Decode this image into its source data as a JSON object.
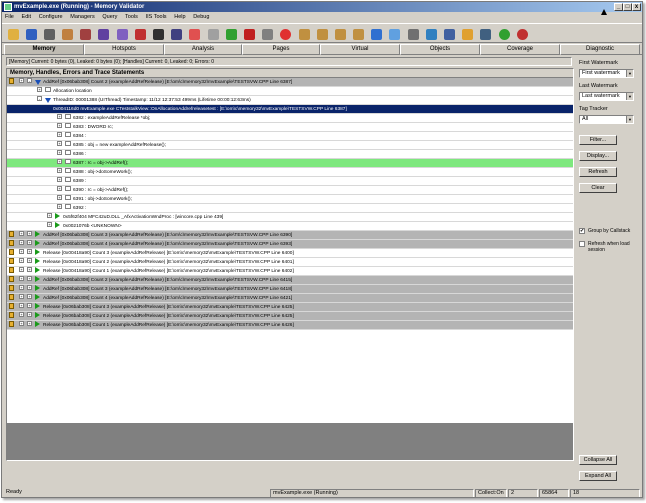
{
  "window": {
    "title": "mvExample.exe (Running) - Memory Validator",
    "controls": {
      "minimize": "_",
      "maximize": "□",
      "close": "x"
    }
  },
  "menu": [
    "File",
    "Edit",
    "Configure",
    "Managers",
    "Query",
    "Tools",
    "IIS Tools",
    "Help",
    "Debug"
  ],
  "toolbar": {
    "icons": [
      "folder-open-icon",
      "save-icon",
      "print-icon",
      "clipboard-icon",
      "book-icon",
      "wand-icon",
      "magic-icon",
      "red-pencil-icon",
      "arrow-icon",
      "pencil-icon",
      "eraser-icon",
      "knife-icon",
      "check-icon",
      "close-icon",
      "stop-icon",
      "record-icon",
      "bag-icon",
      "bag-icon",
      "bag-icon",
      "bag-icon",
      "shield-icon",
      "snowflake-icon",
      "grid-icon",
      "chart-icon",
      "network-icon",
      "lock-icon",
      "person-icon",
      "refresh-green-icon",
      "refresh-red-icon"
    ]
  },
  "tabs": [
    "Memory",
    "Hotspots",
    "Analysis",
    "Pages",
    "Virtual",
    "Objects",
    "Coverage",
    "Diagnostic"
  ],
  "active_tab": "Memory",
  "status_summary": "[Memory] Current: 0 bytes (0), Leaked: 0 bytes (0); [Handles] Current: 0, Leaked: 0; Errors: 0",
  "tree": {
    "header": "Memory, Handles, Errors and Trace Statements",
    "rows": [
      {
        "indent": 0,
        "style": "grey",
        "text": "AddRef [0x06bab308] Count 2 (exampleAddRefRelease) [E:\\om\\c\\memory32\\mvExample\\TESTSVW.CPP Line 6387]",
        "kind": "arrowdown"
      },
      {
        "indent": 1,
        "style": "white",
        "text": "Allocation location",
        "kind": "box"
      },
      {
        "indent": 1,
        "style": "white",
        "text": "ThreadID: 00001388 (UIThread) Timestamp: 11/12 12:37:53 499ms (Lifetime 00:00:12:63ms)",
        "kind": "arrowdown"
      },
      {
        "indent": 2,
        "style": "sel",
        "text": "0x004116d0 mvExample.exe CTeststalkView::OnAllocationAddrefreleasetest : [E:\\om\\c\\memory32\\mvExample\\TESTSVW.CPP Line 6387]",
        "kind": "none"
      },
      {
        "indent": 3,
        "style": "white",
        "text": "6382 :     exampleAddRefRelease     *obj;",
        "kind": "box"
      },
      {
        "indent": 3,
        "style": "white",
        "text": "6383 :     DWORD                   rc;",
        "kind": "box"
      },
      {
        "indent": 3,
        "style": "white",
        "text": "6384 :",
        "kind": "box"
      },
      {
        "indent": 3,
        "style": "white",
        "text": "6385 :     obj = new exampleAddRefRelease();",
        "kind": "box"
      },
      {
        "indent": 3,
        "style": "white",
        "text": "6386 :",
        "kind": "box"
      },
      {
        "indent": 3,
        "style": "green",
        "text": "6387 :     rc = obj->AddRef();",
        "kind": "box"
      },
      {
        "indent": 3,
        "style": "white",
        "text": "6388 :     obj->doSomeWork();",
        "kind": "box"
      },
      {
        "indent": 3,
        "style": "white",
        "text": "6389 :",
        "kind": "box"
      },
      {
        "indent": 3,
        "style": "white",
        "text": "6390 :     rc = obj->AddRef();",
        "kind": "box"
      },
      {
        "indent": 3,
        "style": "white",
        "text": "6391 :     obj->doSomeWork();",
        "kind": "box"
      },
      {
        "indent": 3,
        "style": "white",
        "text": "6392 :",
        "kind": "box"
      },
      {
        "indent": 2,
        "style": "white",
        "text": "0x5f62f404 MFC42uD.DLL _AfxActivationWndProc : [wincore.cpp Line 439]",
        "kind": "arrow"
      },
      {
        "indent": 2,
        "style": "white",
        "text": "0x0021076b <UNKNOWN>",
        "kind": "arrow"
      },
      {
        "indent": 0,
        "style": "grey",
        "text": "AddRef [0x06bab308] Count 3 (exampleAddRefRelease) [E:\\om\\c\\memory32\\mvExample\\TESTSVW.CPP Line 6390]",
        "kind": "arrow"
      },
      {
        "indent": 0,
        "style": "grey",
        "text": "AddRef [0x06bab308] Count 4 (exampleAddRefRelease) [E:\\om\\c\\memory32\\mvExample\\TESTSVW.CPP Line 6393]",
        "kind": "arrow"
      },
      {
        "indent": 0,
        "style": "white",
        "text": "Release [0x00418a90] Count 3 (exampleAddRefRelease) [E:\\om\\c\\memory32\\mvExample\\TESTSVW.CPP Line 6400]",
        "kind": "arrow"
      },
      {
        "indent": 0,
        "style": "white",
        "text": "Release [0x00418a90] Count 2 (exampleAddRefRelease) [E:\\om\\c\\memory32\\mvExample\\TESTSVW.CPP Line 6401]",
        "kind": "arrow"
      },
      {
        "indent": 0,
        "style": "white",
        "text": "Release [0x00418a90] Count 1 (exampleAddRefRelease) [E:\\om\\c\\memory32\\mvExample\\TESTSVW.CPP Line 6402]",
        "kind": "arrow"
      },
      {
        "indent": 0,
        "style": "grey",
        "text": "AddRef [0x06bab308] Count 2 (exampleAddRefRelease) [E:\\om\\c\\memory32\\mvExample\\TESTSVW.CPP Line 6415]",
        "kind": "arrow"
      },
      {
        "indent": 0,
        "style": "grey",
        "text": "AddRef [0x06bab308] Count 3 (exampleAddRefRelease) [E:\\om\\c\\memory32\\mvExample\\TESTSVW.CPP Line 6418]",
        "kind": "arrow"
      },
      {
        "indent": 0,
        "style": "grey",
        "text": "AddRef [0x06bab308] Count 4 (exampleAddRefRelease) [E:\\om\\c\\memory32\\mvExample\\TESTSVW.CPP Line 6421]",
        "kind": "arrow"
      },
      {
        "indent": 0,
        "style": "grey",
        "text": "Release [0x06bab308] Count 3 (exampleAddRefRelease) [E:\\om\\c\\memory32\\mvExample\\TESTSVW.CPP Line 6425]",
        "kind": "arrow"
      },
      {
        "indent": 0,
        "style": "grey",
        "text": "Release [0x06bab308] Count 2 (exampleAddRefRelease) [E:\\om\\c\\memory32\\mvExample\\TESTSVW.CPP Line 6425]",
        "kind": "arrow"
      },
      {
        "indent": 0,
        "style": "grey",
        "text": "Release [0x06bab308] Count 1 (exampleAddRefRelease) [E:\\om\\c\\memory32\\mvExample\\TESTSVW.CPP Line 6426]",
        "kind": "arrow"
      }
    ]
  },
  "side": {
    "first_watermark_label": "First Watermark",
    "first_watermark_value": "First watermark",
    "last_watermark_label": "Last Watermark",
    "last_watermark_value": "Last watermark",
    "tag_tracker_label": "Tag Tracker",
    "tag_tracker_value": "All",
    "filter_btn": "Filter...",
    "display_btn": "Display...",
    "refresh_btn": "Refresh",
    "clear_btn": "Clear",
    "group_by_callstack": "Group by Callstack",
    "group_by_callstack_checked": "✔",
    "refresh_when_load": "Refresh when load session",
    "collapse_all": "Collapse All",
    "expand_all": "Expand All"
  },
  "statusbar": {
    "ready": "Ready",
    "process": "mvExample.exe (Running)",
    "collect": "Collect:On",
    "n1": "2",
    "n2": "65864",
    "n3": "18"
  }
}
